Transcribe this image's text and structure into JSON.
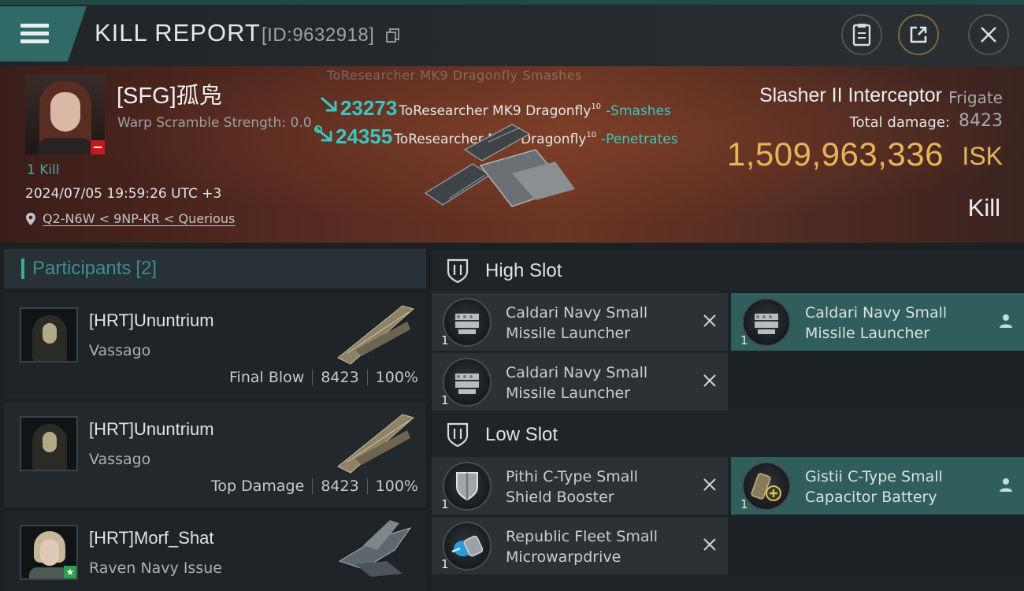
{
  "header": {
    "title": "KILL REPORT",
    "report_id": "[ID:9632918]",
    "icons": [
      "menu-icon",
      "copy-icon",
      "clipboard-icon",
      "share-icon",
      "close-icon"
    ]
  },
  "victim": {
    "name": "[SFG]孤凫",
    "warp_scramble": "Warp Scramble Strength: 0.0",
    "kills": "1 Kill",
    "datetime": "2024/07/05 19:59:26 UTC +3",
    "location": "Q2-N6W < 9NP-KR < Querious",
    "ship_name": "Slasher II Interceptor",
    "ship_class": "Frigate",
    "total_damage_label": "Total damage:",
    "total_damage": "8423",
    "isk_value": "1,509,963,336",
    "isk_unit": "ISK",
    "outcome": "Kill"
  },
  "damage_feed": {
    "faded_line": "ToResearcher MK9 Dragonfly Smashes",
    "lines": [
      {
        "amount": "23273",
        "source": "ToResearcher MK9 Dragonfly",
        "level": "10",
        "effect": "-Smashes"
      },
      {
        "amount": "24355",
        "source": "ToResearcher MK9 Dragonfly",
        "level": "10",
        "effect": "-Penetrates"
      }
    ]
  },
  "participants": {
    "label": "Participants",
    "count": "[2]",
    "items": [
      {
        "name": "[HRT]Ununtrium",
        "ship": "Vassago",
        "role": "Final Blow",
        "damage": "8423",
        "percent": "100%"
      },
      {
        "name": "[HRT]Ununtrium",
        "ship": "Vassago",
        "role": "Top Damage",
        "damage": "8423",
        "percent": "100%"
      },
      {
        "name": "[HRT]Morf_Shat",
        "ship": "Raven Navy Issue"
      }
    ]
  },
  "fitting": {
    "high_slot_label": "High Slot",
    "low_slot_label": "Low Slot",
    "high_slots": [
      {
        "name": "Caldari Navy Small Missile Launcher",
        "qty": "1",
        "status": "destroyed"
      },
      {
        "name": "Caldari Navy Small Missile Launcher",
        "qty": "1",
        "status": "dropped"
      },
      {
        "name": "Caldari Navy Small Missile Launcher",
        "qty": "1",
        "status": "destroyed"
      }
    ],
    "low_slots": [
      {
        "name": "Pithi C-Type Small Shield Booster",
        "qty": "1",
        "status": "destroyed"
      },
      {
        "name": "Gistii C-Type Small Capacitor Battery",
        "qty": "1",
        "status": "dropped"
      },
      {
        "name": "Republic Fleet Small Microwarpdrive",
        "qty": "1",
        "status": "destroyed"
      }
    ]
  },
  "colors": {
    "accent_teal": "#3cc6c2",
    "isk_gold": "#e7b45a",
    "fitted_bg": "#2f5e5b",
    "kill_badge": "#c8181f"
  }
}
